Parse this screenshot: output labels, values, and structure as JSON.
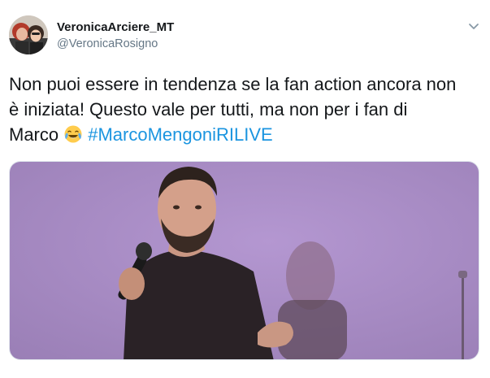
{
  "user": {
    "display_name": "VeronicaArciere_MT",
    "handle": "@VeronicaRosigno",
    "avatar_icon": "profile-photo"
  },
  "menu_icon": "chevron-down-icon",
  "tweet": {
    "line1": "Non puoi essere in tendenza se la fan action ancora non",
    "line2": "è iniziata! Questo vale per tutti, ma non per i fan di",
    "line3_text": "Marco",
    "emoji": "face-with-tears-of-joy",
    "hashtag": "#MarcoMengoniRILIVE"
  },
  "media": {
    "type": "photo",
    "subject": "singer-with-microphone",
    "background_color": "#a78cc2"
  },
  "colors": {
    "text": "#14171a",
    "secondary": "#657786",
    "link": "#1b95e0",
    "border": "#e1e8ed"
  }
}
